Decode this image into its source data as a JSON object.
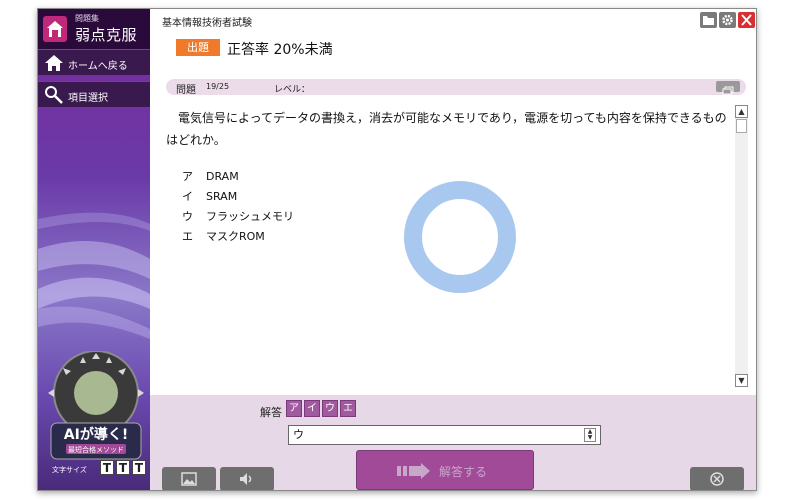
{
  "sidebar": {
    "logo_sub": "問題集",
    "logo_main": "弱点克服",
    "nav_home": "ホームへ戻る",
    "nav_select": "項目選択",
    "ai_text": "AIが導く!",
    "ai_sub": "最短合格メソッド",
    "font_label": "文字サイズ",
    "font_sizes": [
      "T",
      "T",
      "T"
    ]
  },
  "header": {
    "title": "基本情報技術者試験"
  },
  "category": {
    "badge": "出題",
    "text": "正答率 20%未満"
  },
  "question": {
    "label": "問題",
    "number": "19/25",
    "level_label": "レベル：",
    "text": "電気信号によってデータの書換え，消去が可能なメモリであり，電源を切っても内容を保持できるものはどれか。",
    "choices": [
      {
        "key": "ア",
        "text": "DRAM"
      },
      {
        "key": "イ",
        "text": "SRAM"
      },
      {
        "key": "ウ",
        "text": "フラッシュメモリ"
      },
      {
        "key": "エ",
        "text": "マスクROM"
      }
    ]
  },
  "answer": {
    "label": "解答",
    "buttons": [
      "ア",
      "イ",
      "ウ",
      "エ"
    ],
    "value": "ウ",
    "submit_label": "解答する"
  },
  "colors": {
    "sidebar": "#5a2a8a",
    "badge": "#f07a2a",
    "accent": "#a04a98",
    "spinner": "#a8c8f0"
  },
  "icons": {
    "logo": "home-book-icon",
    "home": "house-icon",
    "select": "pointer-icon",
    "folder": "folder-icon",
    "gear": "gear-icon",
    "close": "close-icon",
    "restore": "window-restore-icon",
    "image": "image-icon",
    "sound": "speaker-icon",
    "submit": "arrow-right-icon",
    "loading": "loading-ring-icon"
  }
}
